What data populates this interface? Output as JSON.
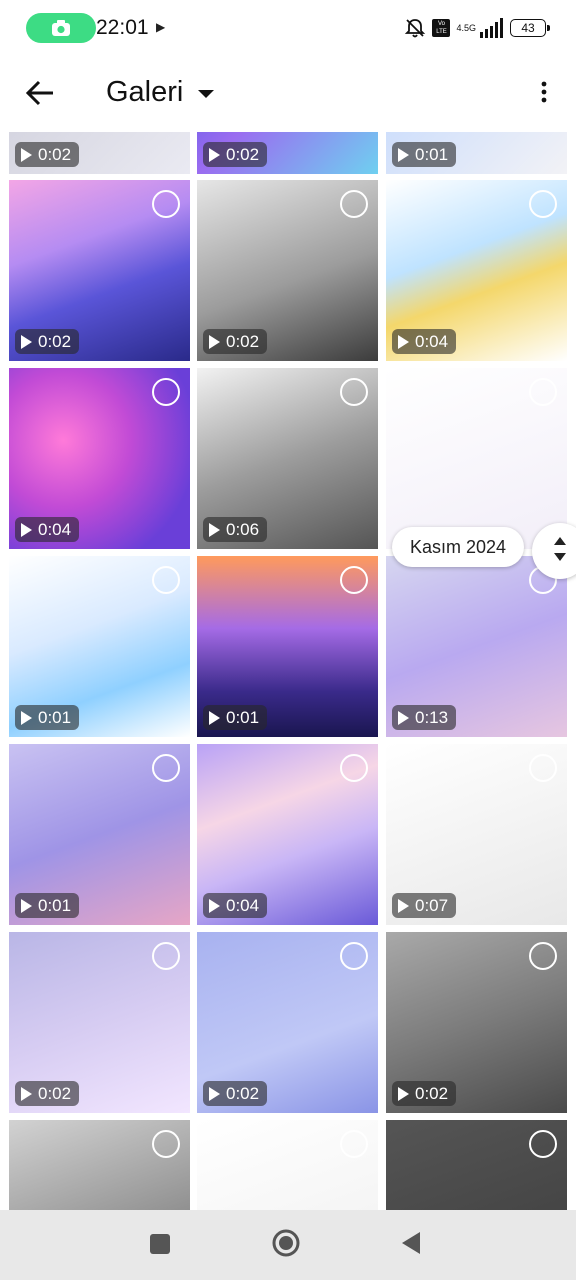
{
  "status_bar": {
    "time": "22:01",
    "network": "4.5G",
    "battery": "43",
    "volte": "Vo LTE",
    "icons": [
      "screen-recorder-icon",
      "play-icon",
      "bell-off-icon",
      "volte-icon",
      "signal-icon",
      "battery-icon"
    ]
  },
  "app_bar": {
    "title": "Galeri",
    "icons": [
      "back-arrow-icon",
      "dropdown-caret-icon",
      "more-vert-icon"
    ]
  },
  "date_chip": "Kasım 2024",
  "tiles": [
    {
      "duration": "0:02",
      "bg": "linear-gradient(135deg,#c9c9d6,#eaeaf2)"
    },
    {
      "duration": "0:02",
      "bg": "linear-gradient(135deg,#3b4fe0,#9a6cf0,#6fd0f0)"
    },
    {
      "duration": "0:01",
      "bg": "linear-gradient(135deg,#b9d3ff,#f2f2f6)"
    },
    {
      "duration": "0:02",
      "bg": "linear-gradient(160deg,#f3a6e6 0%,#b58cf2 35%,#5a55d8 60%,#2a2a8a 100%)"
    },
    {
      "duration": "0:02",
      "bg": "linear-gradient(160deg,#e6e6e6 0%,#9c9c9c 55%,#3c3c3c 100%)"
    },
    {
      "duration": "0:04",
      "bg": "linear-gradient(160deg,#ffffff 0%,#bfe3ff 40%,#f4d76b 60%,#ffffff 100%)"
    },
    {
      "duration": "0:04",
      "bg": "radial-gradient(circle at 30% 40%,#ff7ad9,#c24bd6 40%,#6a3fd8 80%)"
    },
    {
      "duration": "0:06",
      "bg": "linear-gradient(160deg,#f2f2f2 0%,#9d9d9d 50%,#555 100%)"
    },
    {
      "duration": "",
      "bg": "linear-gradient(160deg,#ffffff,#f2eef8)"
    },
    {
      "duration": "0:01",
      "bg": "linear-gradient(160deg,#ffffff 0%,#d9eaff 40%,#8fd0ff 70%,#ffffff 100%)"
    },
    {
      "duration": "0:01",
      "bg": "linear-gradient(180deg,#ff9a5c 0%,#a56be6 40%,#3a2a8a 75%,#1a1650 100%)"
    },
    {
      "duration": "0:13",
      "bg": "linear-gradient(160deg,#d6d6f0 0%,#b9a9f0 50%,#e6c6e0 100%)"
    },
    {
      "duration": "0:01",
      "bg": "linear-gradient(160deg,#c9c2f2 0%,#9f94e6 50%,#e6a6c6 100%)"
    },
    {
      "duration": "0:04",
      "bg": "linear-gradient(160deg,#b9a2f6 0%,#f6d6e6 35%,#c9b6f6 60%,#6a5ad8 100%)"
    },
    {
      "duration": "0:07",
      "bg": "linear-gradient(160deg,#ffffff,#e8e8e8)"
    },
    {
      "duration": "0:02",
      "bg": "linear-gradient(160deg,#b9b6e6 0%,#d6ccf2 50%,#f2e6ff 100%)"
    },
    {
      "duration": "0:02",
      "bg": "linear-gradient(160deg,#a8b2f0 0%,#c0c8f6 60%,#8a94e6 100%)"
    },
    {
      "duration": "0:02",
      "bg": "linear-gradient(160deg,#a9a9a9 0%,#7c7c7c 50%,#4a4a4a 100%)"
    },
    {
      "duration": "",
      "bg": "linear-gradient(160deg,#d2d2d2,#6a6a6a)"
    },
    {
      "duration": "",
      "bg": "linear-gradient(160deg,#ffffff,#efefef)"
    },
    {
      "duration": "",
      "bg": "linear-gradient(160deg,#555,#3c3c3c)"
    }
  ],
  "nav_bar": {
    "icons": [
      "recents-square-icon",
      "home-circle-icon",
      "back-triangle-icon"
    ]
  }
}
